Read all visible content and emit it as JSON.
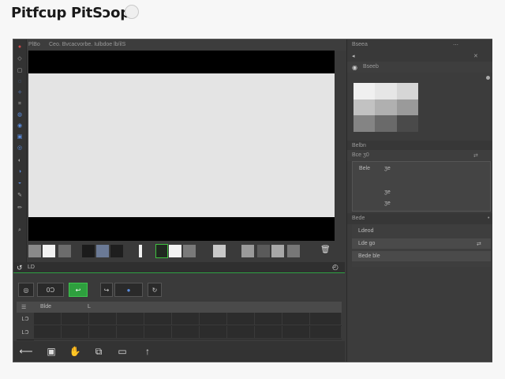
{
  "app": {
    "title": "Pitfcup PitSᴐop"
  },
  "doc_bar": {
    "tab_text": "PlBo",
    "tab_name": "Ceo. Bvcacvorbe. Iulbdoe lb/ilS"
  },
  "status": {
    "left_label": "LD"
  },
  "timeline": {
    "btn_time": "0Ɔ",
    "btn_play": "↩",
    "btn_frame": "↪",
    "btn_dot": "●",
    "btn_loop": "↻",
    "header_label": "Blde",
    "header_mark": "L",
    "rows": [
      "LƆ",
      "LƆ"
    ]
  },
  "bottom_bar": {
    "icons": [
      "arrow-left-icon",
      "frame-icon",
      "hand-icon",
      "layers-icon",
      "window-icon",
      "arrow-up-icon"
    ]
  },
  "right_panel": {
    "section1_title": "Bseea",
    "section1_sub": "Bseeb",
    "section2_title": "Belbn",
    "section2_sub": "Bce ʒ0",
    "layer_label": "Bele",
    "layer_items": [
      "ʒe",
      "ʒe",
      "ʒe"
    ],
    "section3_title": "Bede",
    "section3_items": [
      "Ldeod",
      "Lde ɡo",
      "Bede ble"
    ]
  },
  "colors": {
    "accent_green": "#2e9f3e",
    "panel_bg": "#3c3c3c",
    "window_bg": "#3a3a3a",
    "canvas_bg": "#e4e4e4"
  }
}
